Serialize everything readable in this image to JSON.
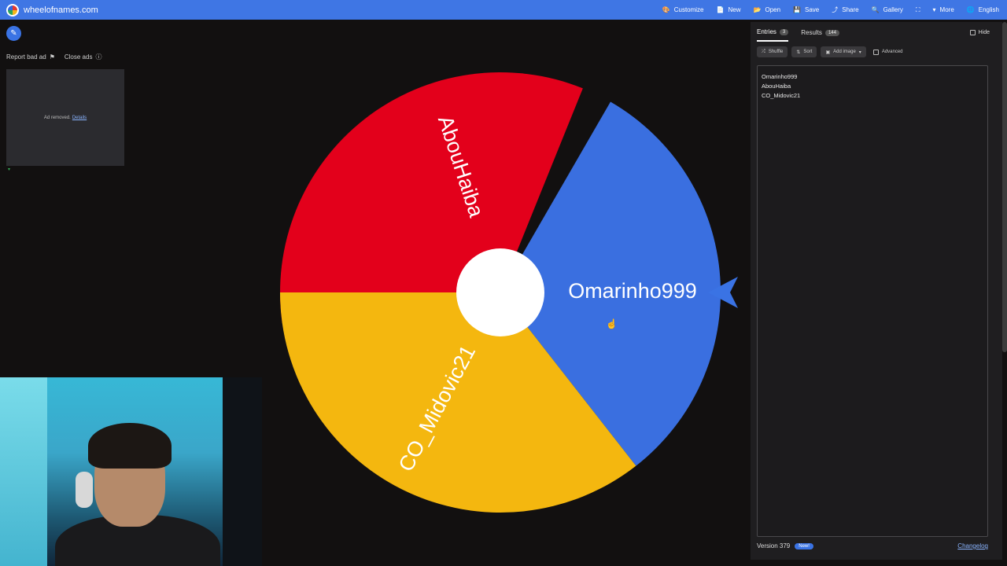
{
  "topbar": {
    "brand": "wheelofnames.com",
    "nav": [
      {
        "icon": "palette-icon",
        "glyph": "🎨",
        "label": "Customize"
      },
      {
        "icon": "new-file-icon",
        "glyph": "📄",
        "label": "New"
      },
      {
        "icon": "folder-icon",
        "glyph": "📂",
        "label": "Open"
      },
      {
        "icon": "save-icon",
        "glyph": "💾",
        "label": "Save"
      },
      {
        "icon": "share-icon",
        "glyph": "⤴",
        "label": "Share"
      },
      {
        "icon": "search-icon",
        "glyph": "🔍",
        "label": "Gallery"
      },
      {
        "icon": "fullscreen-icon",
        "glyph": "⛶",
        "label": ""
      },
      {
        "icon": "chevron-down-icon",
        "glyph": "▾",
        "label": "More"
      },
      {
        "icon": "globe-icon",
        "glyph": "🌐",
        "label": "English"
      }
    ]
  },
  "ads": {
    "report_label": "Report bad ad",
    "close_label": "Close ads",
    "removed_text": "Ad removed.",
    "details_link": "Details"
  },
  "wheel": {
    "segments": [
      {
        "label": "Omarinho999",
        "color": "#3a6fe0"
      },
      {
        "label": "AbouHaiba",
        "color": "#e3001b"
      },
      {
        "label": "CO_Midovic21",
        "color": "#f4b70f"
      }
    ],
    "center_color": "#ffffff",
    "pointer_color": "#3a73e4"
  },
  "panel": {
    "tabs": [
      {
        "label": "Entries",
        "count": "3"
      },
      {
        "label": "Results",
        "count": "144"
      }
    ],
    "hide_label": "Hide",
    "toolbar": {
      "shuffle": "Shuffle",
      "sort": "Sort",
      "add_image": "Add image",
      "advanced": "Advanced"
    },
    "entries": [
      "Omarinho999",
      "AbouHaiba",
      "CO_Midovic21"
    ],
    "version": "Version 379",
    "new_badge": "New!",
    "changelog": "Changelog"
  }
}
